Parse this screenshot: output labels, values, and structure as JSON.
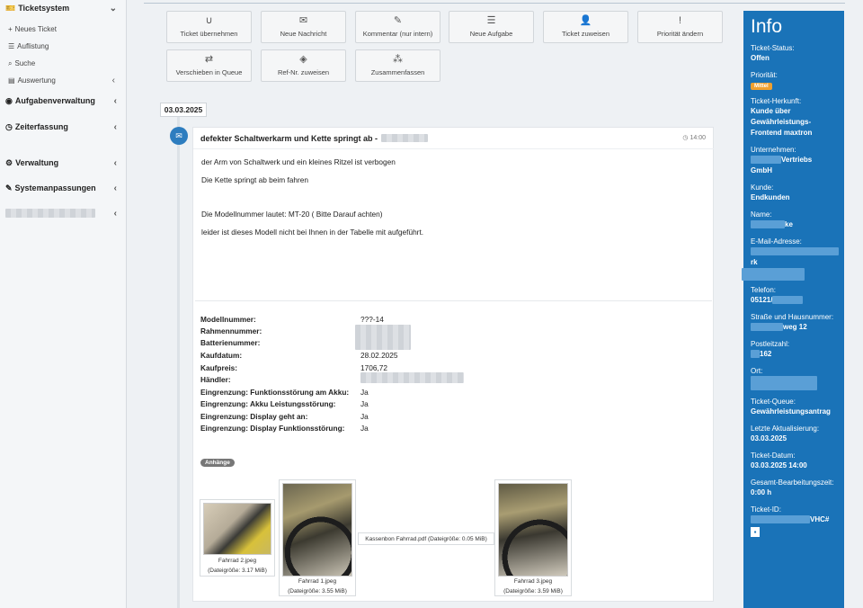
{
  "sidebar": {
    "ticketsystem": "Ticketsystem",
    "neues_ticket": "Neues Ticket",
    "auflistung": "Auflistung",
    "suche": "Suche",
    "auswertung": "Auswertung",
    "aufgabenverwaltung": "Aufgabenverwaltung",
    "zeiterfassung": "Zeiterfassung",
    "verwaltung": "Verwaltung",
    "systemanpassungen": "Systemanpassungen"
  },
  "actions": [
    {
      "label": "Ticket übernehmen",
      "icon": "magnet-icon"
    },
    {
      "label": "Neue Nachricht",
      "icon": "envelope-icon"
    },
    {
      "label": "Kommentar (nur intern)",
      "icon": "edit-icon"
    },
    {
      "label": "Neue Aufgabe",
      "icon": "list-icon"
    },
    {
      "label": "Ticket zuweisen",
      "icon": "user-icon"
    },
    {
      "label": "Priorität ändern",
      "icon": "exclamation-icon"
    },
    {
      "label": "Verschieben in Queue",
      "icon": "shuffle-icon"
    },
    {
      "label": "Ref-Nr. zuweisen",
      "icon": "cube-icon"
    },
    {
      "label": "Zusammenfassen",
      "icon": "cubes-icon"
    }
  ],
  "timeline": {
    "date": "03.03.2025"
  },
  "message": {
    "subject": "defekter Schaltwerkarm und Kette springt ab -",
    "time": "14:00",
    "lines": [
      "der Arm von Schaltwerk und ein kleines Ritzel ist verbogen",
      "Die Kette springt ab beim fahren",
      "Die Modellnummer lautet: MT-20 ( Bitte Darauf achten)",
      "leider ist dieses Modell nicht bei Ihnen in der Tabelle mit aufgeführt."
    ]
  },
  "details": [
    {
      "label": "Modellnummer:",
      "value": "???-14"
    },
    {
      "label": "Rahmennummer:",
      "value": ""
    },
    {
      "label": "Batterienummer:",
      "value": ""
    },
    {
      "label": "Kaufdatum:",
      "value": "28.02.2025"
    },
    {
      "label": "Kaufpreis:",
      "value": "1706,72"
    },
    {
      "label": "Händler:",
      "value": ""
    },
    {
      "label": "Eingrenzung: Funktionsstörung am Akku:",
      "value": "Ja"
    },
    {
      "label": "Eingrenzung: Akku Leistungsstörung:",
      "value": "Ja"
    },
    {
      "label": "Eingrenzung: Display geht an:",
      "value": "Ja"
    },
    {
      "label": "Eingrenzung: Display Funktionsstörung:",
      "value": "Ja"
    }
  ],
  "attachments": {
    "badge": "Anhänge",
    "files": [
      {
        "name": "Fahrrad 2.jpeg",
        "size": "(Dateigröße: 3.17 MiB)"
      },
      {
        "name": "Fahrrad 1.jpeg",
        "size": "(Dateigröße: 3.55 MiB)"
      },
      {
        "name": "Kassenbon Fahrrad.pdf (Dateigröße: 0.05 MiB)",
        "size": ""
      },
      {
        "name": "Fahrrad 3.jpeg",
        "size": "(Dateigröße: 3.59 MiB)"
      }
    ]
  },
  "info": {
    "title": "Info",
    "status_label": "Ticket-Status:",
    "status": "Offen",
    "priority_label": "Priorität:",
    "priority": "Mittel",
    "origin_label": "Ticket-Herkunft:",
    "origin": "Kunde über Gewährleistungs-Frontend maxtron",
    "company_label": "Unternehmen:",
    "company_a": "Vertriebs",
    "company_b": "GmbH",
    "customer_label": "Kunde:",
    "customer": "Endkunden",
    "name_label": "Name:",
    "name_suffix": "ke",
    "email_label": "E-Mail-Adresse:",
    "email_suffix": "rk",
    "phone_label": "Telefon:",
    "phone_prefix": "05121/",
    "street_label": "Straße und Hausnummer:",
    "street_suffix": "weg 12",
    "zip_label": "Postleitzahl:",
    "zip_suffix": "162",
    "city_label": "Ort:",
    "queue_label": "Ticket-Queue:",
    "queue": "Gewährleistungsantrag",
    "updated_label": "Letzte Aktualisierung:",
    "updated": "03.03.2025",
    "date_label": "Ticket-Datum:",
    "date": "03.03.2025 14:00",
    "worktime_label": "Gesamt-Bearbeitungszeit:",
    "worktime": "0:00 h",
    "id_label": "Ticket-ID:",
    "id_suffix": "VHC#"
  }
}
